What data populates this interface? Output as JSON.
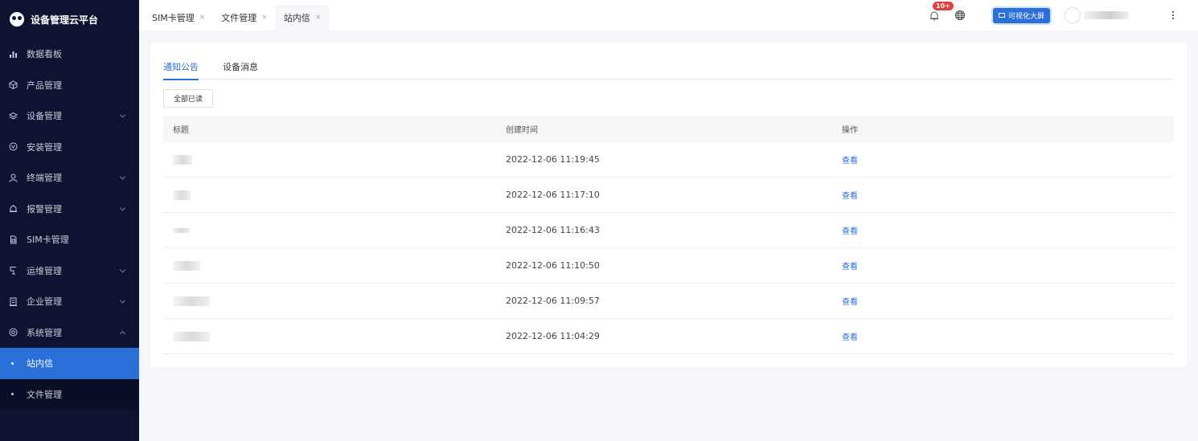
{
  "app": {
    "title": "设备管理云平台"
  },
  "sidebar": {
    "items": [
      {
        "label": "数据看板",
        "icon": "bar-chart-icon",
        "has_children": false
      },
      {
        "label": "产品管理",
        "icon": "cube-icon",
        "has_children": false
      },
      {
        "label": "设备管理",
        "icon": "layers-icon",
        "has_children": true
      },
      {
        "label": "安装管理",
        "icon": "tool-icon",
        "has_children": false
      },
      {
        "label": "终端管理",
        "icon": "user-icon",
        "has_children": true
      },
      {
        "label": "报警管理",
        "icon": "alarm-icon",
        "has_children": true
      },
      {
        "label": "SIM卡管理",
        "icon": "sim-icon",
        "has_children": false
      },
      {
        "label": "运维管理",
        "icon": "wrench-icon",
        "has_children": true
      },
      {
        "label": "企业管理",
        "icon": "building-icon",
        "has_children": true
      },
      {
        "label": "系统管理",
        "icon": "gear-icon",
        "has_children": true,
        "expanded": true
      }
    ],
    "sub_items": [
      {
        "label": "站内信",
        "active": true
      },
      {
        "label": "文件管理",
        "active": false
      }
    ]
  },
  "header": {
    "tabs": [
      {
        "label": "SIM卡管理",
        "close": "×",
        "active": false
      },
      {
        "label": "文件管理",
        "close": "×",
        "active": false
      },
      {
        "label": "站内信",
        "close": "×",
        "active": true
      }
    ],
    "notification_badge": "10+",
    "visualize_button": "可视化大屏"
  },
  "main": {
    "tabs": [
      {
        "label": "通知公告",
        "active": true
      },
      {
        "label": "设备消息",
        "active": false
      }
    ],
    "mark_all_read": "全部已读",
    "table": {
      "columns": [
        "标题",
        "创建时间",
        "操作"
      ],
      "rows": [
        {
          "created": "2022-12-06 11:19:45",
          "action": "查看"
        },
        {
          "created": "2022-12-06 11:17:10",
          "action": "查看"
        },
        {
          "created": "2022-12-06 11:16:43",
          "action": "查看"
        },
        {
          "created": "2022-12-06 11:10:50",
          "action": "查看"
        },
        {
          "created": "2022-12-06 11:09:57",
          "action": "查看"
        },
        {
          "created": "2022-12-06 11:04:29",
          "action": "查看"
        }
      ]
    }
  },
  "colors": {
    "sidebar_bg": "#0d1330",
    "accent": "#2b6fd8",
    "badge": "#e63d3d"
  }
}
